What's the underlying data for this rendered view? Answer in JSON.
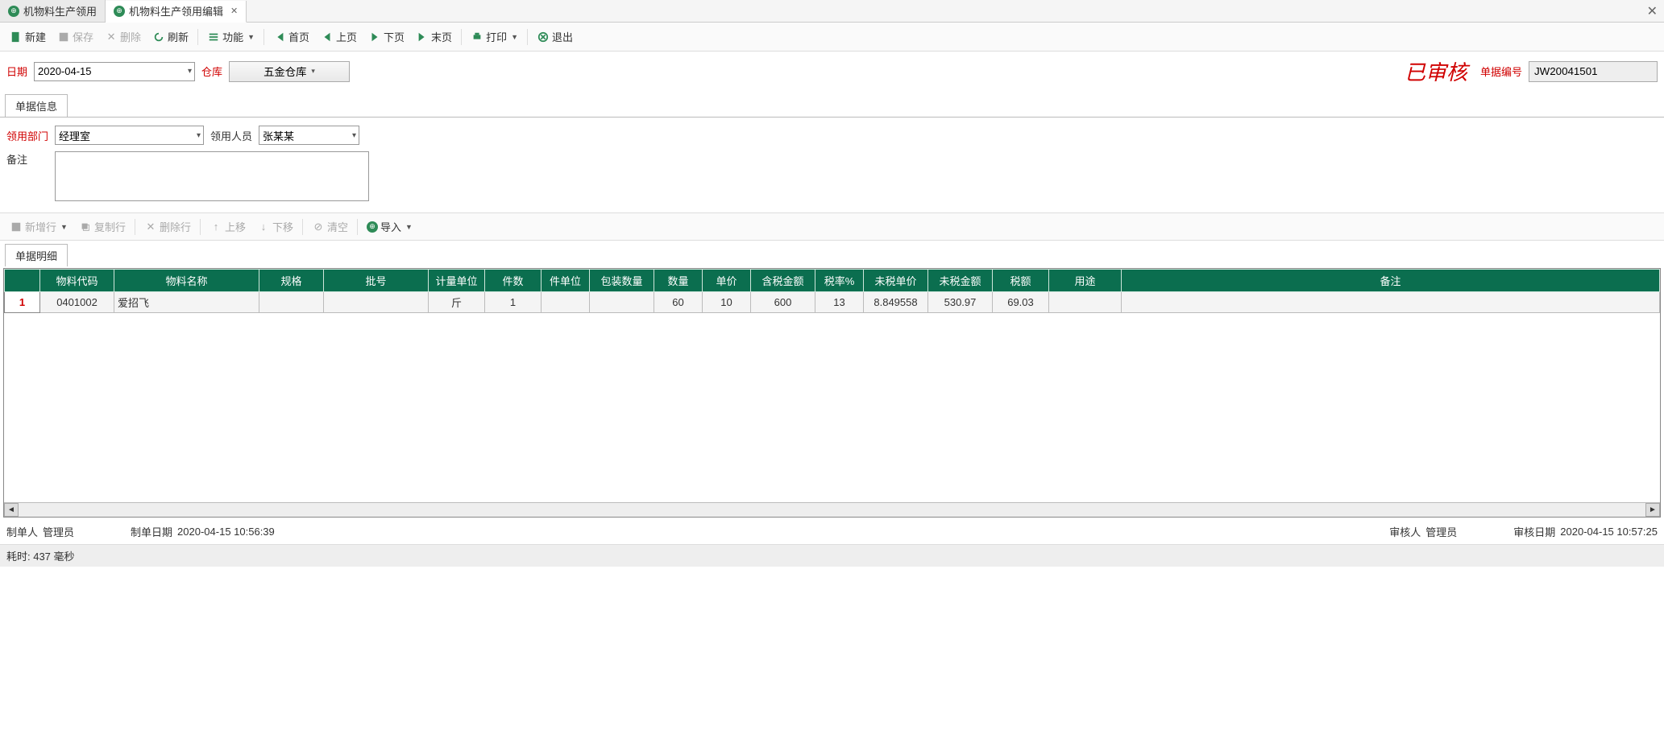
{
  "tabs": {
    "t0": "机物料生产领用",
    "t1": "机物料生产领用编辑"
  },
  "toolbar": {
    "new": "新建",
    "save": "保存",
    "delete": "删除",
    "refresh": "刷新",
    "function": "功能",
    "first": "首页",
    "prev": "上页",
    "next": "下页",
    "last": "末页",
    "print": "打印",
    "exit": "退出"
  },
  "header": {
    "date_label": "日期",
    "date_value": "2020-04-15",
    "warehouse_label": "仓库",
    "warehouse_value": "五金仓库",
    "audited": "已审核",
    "docnum_label": "单据编号",
    "docnum_value": "JW20041501"
  },
  "section1": {
    "title": "单据信息",
    "dept_label": "领用部门",
    "dept_value": "经理室",
    "person_label": "领用人员",
    "person_value": "张某某",
    "remark_label": "备注",
    "remark_value": ""
  },
  "detail_toolbar": {
    "addrow": "新增行",
    "copyrow": "复制行",
    "delrow": "删除行",
    "moveup": "上移",
    "movedown": "下移",
    "clear": "清空",
    "import": "导入"
  },
  "section2": {
    "title": "单据明细"
  },
  "grid": {
    "headers": [
      "物料代码",
      "物料名称",
      "规格",
      "批号",
      "计量单位",
      "件数",
      "件单位",
      "包装数量",
      "数量",
      "单价",
      "含税金额",
      "税率%",
      "未税单价",
      "未税金额",
      "税额",
      "用途",
      "备注"
    ],
    "rows": [
      {
        "n": "1",
        "code": "0401002",
        "name": "爱招飞",
        "spec": "",
        "batch": "",
        "uom": "斤",
        "pcs": "1",
        "pcsu": "",
        "pack": "",
        "qty": "60",
        "price": "10",
        "taxamt": "600",
        "taxrate": "13",
        "netprice": "8.849558",
        "netamt": "530.97",
        "tax": "69.03",
        "use": "",
        "remark": ""
      }
    ]
  },
  "footer": {
    "maker_label": "制单人",
    "maker_value": "管理员",
    "make_date_label": "制单日期",
    "make_date_value": "2020-04-15 10:56:39",
    "auditor_label": "审核人",
    "auditor_value": "管理员",
    "audit_date_label": "审核日期",
    "audit_date_value": "2020-04-15 10:57:25"
  },
  "status": "耗时: 437 毫秒"
}
